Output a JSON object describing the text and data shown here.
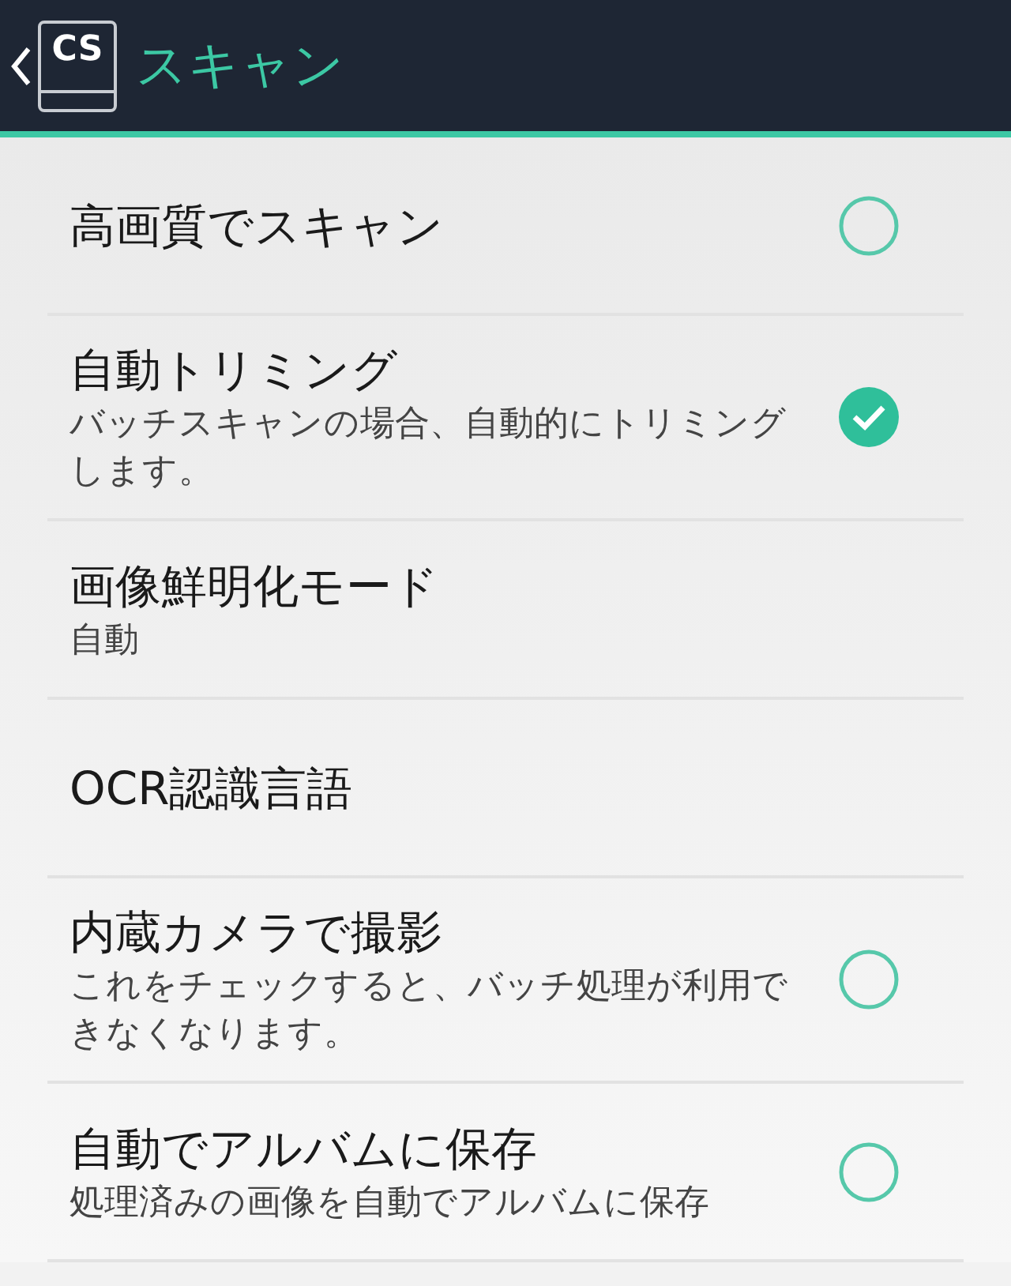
{
  "app_bar": {
    "logo_text": "CS",
    "title": "スキャン"
  },
  "settings": [
    {
      "kind": "checkbox",
      "title": "高画質でスキャン",
      "checked": false
    },
    {
      "kind": "checkbox",
      "title": "自動トリミング",
      "summary": "バッチスキャンの場合、自動的にトリミングします。",
      "checked": true
    },
    {
      "kind": "plain",
      "title": "画像鮮明化モード",
      "summary": "自動"
    },
    {
      "kind": "plain",
      "title": "OCR認識言語"
    },
    {
      "kind": "checkbox",
      "title": "内蔵カメラで撮影",
      "summary": "これをチェックすると、バッチ処理が利用できなくなります。",
      "checked": false
    },
    {
      "kind": "checkbox",
      "title": "自動でアルバムに保存",
      "summary": "処理済みの画像を自動でアルバムに保存",
      "checked": false
    }
  ]
}
